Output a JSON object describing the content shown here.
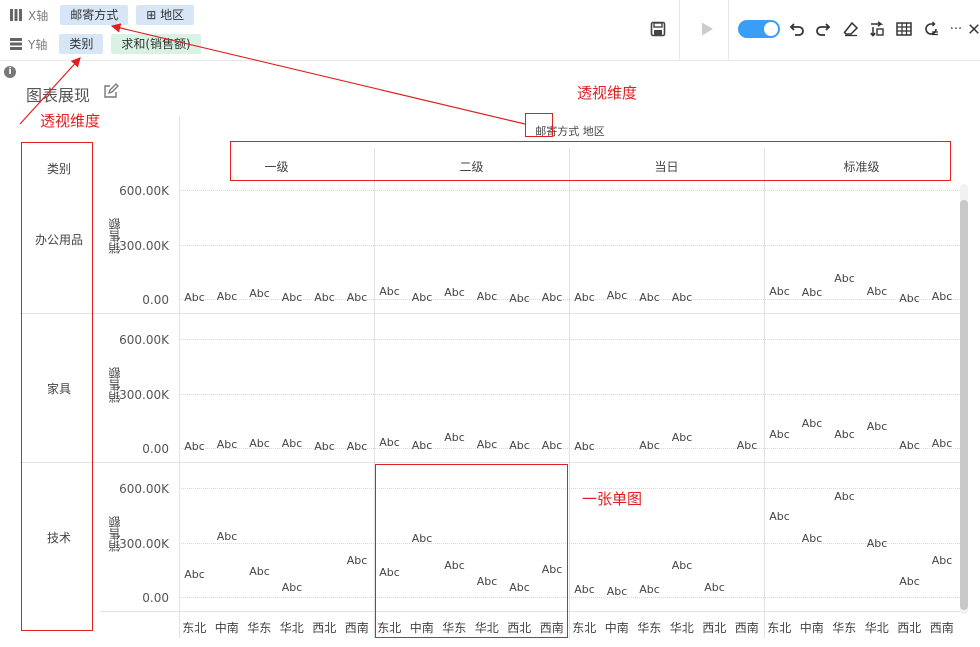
{
  "toolbar": {
    "x_axis_label": "X轴",
    "x_pill_1": "邮寄方式",
    "x_pill_2": "地区",
    "x_pill_2_icon": "plus-square-icon",
    "y_axis_label": "Y轴",
    "y_pill_1": "类别",
    "y_pill_2": "求和(销售额)",
    "more_glyph": "···",
    "toggle_on": true
  },
  "chart_title": "图表展现",
  "annotations": {
    "top_right": "透视维度",
    "left": "透视维度",
    "single_chart": "一张单图"
  },
  "header_field": "邮寄方式 地区",
  "row_field_label": "类别",
  "column_groups": [
    "一级",
    "二级",
    "当日",
    "标准级"
  ],
  "row_groups": [
    "办公用品",
    "家具",
    "技术"
  ],
  "y_axis_title": "销售额",
  "y_ticks": [
    "600.00K",
    "300.00K",
    "0.00"
  ],
  "x_categories": [
    "东北",
    "中南",
    "华东",
    "华北",
    "西北",
    "西南"
  ],
  "point_label": "Abc",
  "chart_data": {
    "type": "scatter",
    "x_axis_field": "邮寄方式 地区",
    "y_axis_field": "销售额",
    "column_groups": [
      "一级",
      "二级",
      "当日",
      "标准级"
    ],
    "row_groups": [
      "办公用品",
      "家具",
      "技术"
    ],
    "categories": [
      "东北",
      "中南",
      "华东",
      "华北",
      "西北",
      "西南"
    ],
    "ylim": [
      0,
      600000
    ],
    "y_tick_labels": [
      "600.00K",
      "300.00K",
      "0.00"
    ],
    "point_label": "Abc",
    "values": {
      "办公用品": {
        "一级": [
          5000,
          10000,
          25000,
          3000,
          3000,
          5000
        ],
        "二级": [
          40000,
          5000,
          35000,
          10000,
          0,
          5000
        ],
        "当日": [
          5000,
          15000,
          5000,
          5000,
          null,
          null
        ],
        "标准级": [
          40000,
          35000,
          110000,
          40000,
          0,
          10000
        ]
      },
      "家具": {
        "一级": [
          5000,
          15000,
          20000,
          20000,
          5000,
          5000
        ],
        "二级": [
          25000,
          10000,
          55000,
          15000,
          10000,
          10000
        ],
        "当日": [
          5000,
          null,
          10000,
          55000,
          null,
          10000
        ],
        "标准级": [
          70000,
          130000,
          70000,
          115000,
          10000,
          20000
        ]
      },
      "技术": {
        "一级": [
          120000,
          330000,
          140000,
          50000,
          null,
          200000
        ],
        "二级": [
          130000,
          320000,
          170000,
          80000,
          50000,
          150000
        ],
        "当日": [
          40000,
          30000,
          40000,
          170000,
          50000,
          null
        ],
        "标准级": [
          440000,
          320000,
          550000,
          290000,
          80000,
          200000
        ]
      }
    }
  },
  "colors": {
    "annotation_red": "#e02020",
    "pill_blue": "#d6e6f6",
    "pill_green": "#d9f2e4",
    "toggle_blue": "#3a9ef7"
  }
}
